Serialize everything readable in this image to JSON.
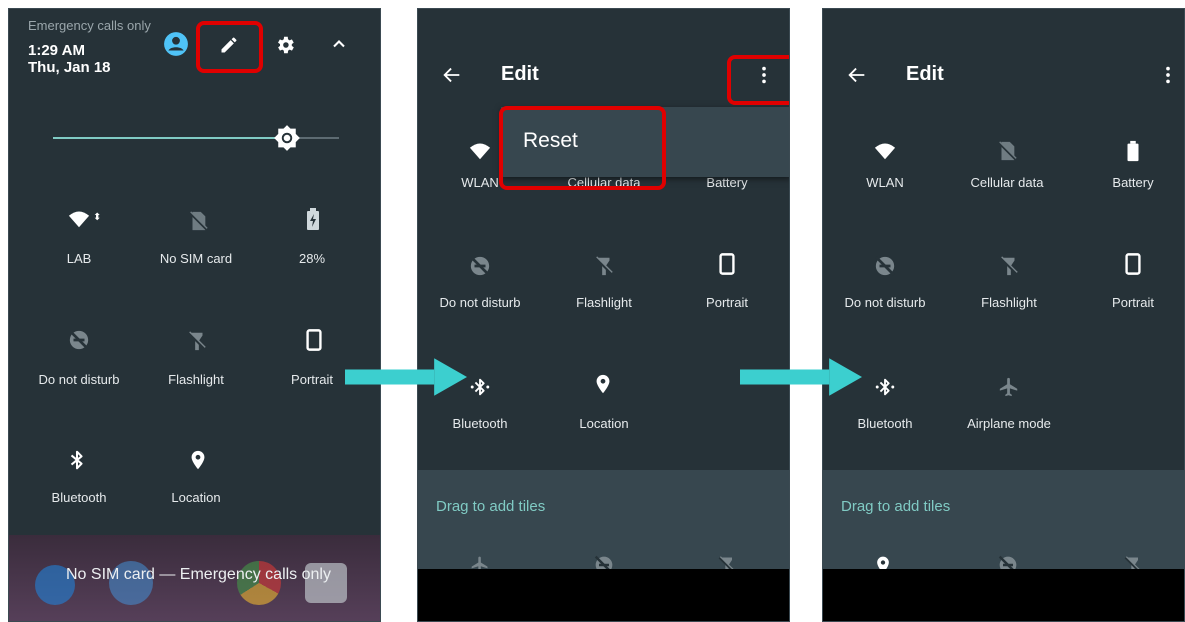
{
  "colors": {
    "panel_bg": "#263238",
    "accent": "#80cbc4",
    "highlight": "#e00000",
    "arrow": "#3ccfcf"
  },
  "panel1": {
    "status_text": "Emergency calls only",
    "time": "1:29 AM",
    "date": "Thu, Jan 18",
    "icons": [
      "account-icon",
      "edit-icon",
      "settings-icon",
      "collapse-icon"
    ],
    "tiles": [
      {
        "label": "LAB",
        "icon": "wifi-icon"
      },
      {
        "label": "No SIM card",
        "icon": "no-sim-icon"
      },
      {
        "label": "28%",
        "icon": "battery-charging-icon"
      },
      {
        "label": "Do not disturb",
        "icon": "dnd-icon"
      },
      {
        "label": "Flashlight",
        "icon": "flashlight-icon"
      },
      {
        "label": "Portrait",
        "icon": "portrait-icon"
      },
      {
        "label": "Bluetooth",
        "icon": "bluetooth-icon"
      },
      {
        "label": "Location",
        "icon": "location-icon"
      }
    ],
    "footer_text": "No SIM card — Emergency calls only"
  },
  "panel2": {
    "title": "Edit",
    "menu_item": "Reset",
    "tiles": [
      {
        "label": "WLAN"
      },
      {
        "label": "Cellular data"
      },
      {
        "label": "Battery"
      },
      {
        "label": "Do not disturb"
      },
      {
        "label": "Flashlight"
      },
      {
        "label": "Portrait"
      },
      {
        "label": "Bluetooth"
      },
      {
        "label": "Location"
      }
    ],
    "drag_label": "Drag to add tiles"
  },
  "panel3": {
    "title": "Edit",
    "tiles": [
      {
        "label": "WLAN"
      },
      {
        "label": "Cellular data"
      },
      {
        "label": "Battery"
      },
      {
        "label": "Do not disturb"
      },
      {
        "label": "Flashlight"
      },
      {
        "label": "Portrait"
      },
      {
        "label": "Bluetooth"
      },
      {
        "label": "Airplane mode"
      }
    ],
    "drag_label": "Drag to add tiles"
  }
}
